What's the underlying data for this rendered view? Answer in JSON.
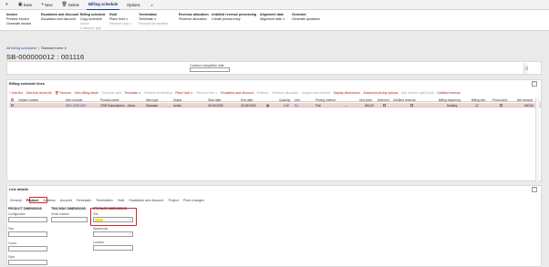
{
  "app_bar": {
    "save": "Save",
    "new": "New",
    "delete": "Delete",
    "tabs": [
      "Billing schedule",
      "Options"
    ]
  },
  "ribbon": {
    "groups": [
      {
        "title": "Invoice",
        "items": [
          {
            "label": "Preview invoice",
            "disabled": false
          },
          {
            "label": "Generate invoice",
            "disabled": false
          }
        ]
      },
      {
        "title": "Escalation and discount",
        "items": [
          {
            "label": "Escalation and discount",
            "disabled": false
          }
        ]
      },
      {
        "title": "Billing schedule",
        "items": [
          {
            "label": "Copy schedule",
            "disabled": false
          },
          {
            "label": "Active",
            "disabled": true
          },
          {
            "label": "Customer split",
            "disabled": true
          }
        ]
      },
      {
        "title": "Hold",
        "items": [
          {
            "label": "Place hold ∨",
            "disabled": false
          },
          {
            "label": "Remove hold ∨",
            "disabled": true
          }
        ]
      },
      {
        "title": "Termination",
        "items": [
          {
            "label": "Terminate ∨",
            "disabled": false
          },
          {
            "label": "Remove termination",
            "disabled": true
          }
        ]
      },
      {
        "title": "Revenue allocation",
        "items": [
          {
            "label": "Revenue allocation",
            "disabled": false
          }
        ]
      },
      {
        "title": "Unbilled revenue processing",
        "items": [
          {
            "label": "Create journal entry",
            "disabled": false
          }
        ]
      },
      {
        "title": "Alignment date",
        "items": [
          {
            "label": "Alignment date ∨",
            "disabled": false
          }
        ]
      },
      {
        "title": "Generate",
        "items": [
          {
            "label": "Generate quotation",
            "disabled": false
          }
        ]
      }
    ]
  },
  "breadcrumb": {
    "link": "All billing schedules",
    "view": "Standard view ∨"
  },
  "page_title": "SB-000000012 : 001116",
  "top_panel": {
    "field_label": "Contract completion date"
  },
  "lines": {
    "title": "Billing schedule lines",
    "toolbar": [
      {
        "label": "+ Add line",
        "disabled": false
      },
      {
        "label": "Add from items list",
        "disabled": false
      },
      {
        "label": "🗑 Remove",
        "disabled": false
      },
      {
        "label": "View billing detail",
        "disabled": false
      },
      {
        "label": "Customer split",
        "disabled": true
      },
      {
        "label": "Terminate ∨",
        "disabled": false
      },
      {
        "label": "Remove termination",
        "disabled": true
      },
      {
        "label": "Place hold ∨",
        "disabled": false
      },
      {
        "label": "Remove hold ∨",
        "disabled": true
      },
      {
        "label": "Escalation and discount",
        "disabled": false
      },
      {
        "label": "Reflexes",
        "disabled": true
      },
      {
        "label": "Revenue allocation",
        "disabled": true
      },
      {
        "label": "Support and renewal",
        "disabled": true
      },
      {
        "label": "Display dimensions",
        "disabled": false
      },
      {
        "label": "Advanced pricing options",
        "disabled": false
      },
      {
        "label": "Add revenue split (hold)",
        "disabled": true
      },
      {
        "label": "Unbilled revenue",
        "disabled": false
      }
    ],
    "columns": [
      "Variant number",
      "Item number",
      "Product name",
      "Item type",
      "Status",
      "Start date",
      "End date",
      "Quantity",
      "Unit",
      "Pricing method",
      "Unit price",
      "Deferred",
      "Unbilled revenue",
      "Billing frequency",
      "Billing inte...",
      "Period amt...",
      "Net amount"
    ],
    "row": {
      "item_number": "SBS-CRM-MSY",
      "product_name": "CRM Subscription – Mont...",
      "item_type": "Standard",
      "status": "Active",
      "start_date": "01/04/2025",
      "end_date": "31/03/2026",
      "quantity": "1.00",
      "unit": "EA",
      "pricing_method": "Flat",
      "unit_price": "500.00",
      "billing_frequency": "Monthly",
      "billing_interval": "12",
      "net_amount": "500.00"
    }
  },
  "details": {
    "title": "Line details",
    "tabs": [
      "General",
      "Product",
      "Address",
      "Account",
      "Renewals",
      "Termination",
      "Hold",
      "Escalation and discount",
      "Project",
      "Price changes"
    ],
    "active_tab": "Product",
    "product_dimensions": {
      "heading": "PRODUCT DIMENSIONS",
      "fields": [
        "Configuration",
        "Size",
        "Colour",
        "Style"
      ]
    },
    "tracking_dimensions": {
      "heading": "TRACKING DIMENSIONS",
      "fields": [
        "Serial number"
      ]
    },
    "storage_dimensions": {
      "heading": "STORAGE DIMENSIONS",
      "fields": [
        "Site",
        "Warehouse",
        "Location"
      ]
    }
  },
  "colors": {
    "accent": "#b81a1a",
    "highlight_box": "#d3222f",
    "selected_row": "#efd5d3",
    "site_value": "#f2e63a",
    "link": "#2855b8"
  }
}
